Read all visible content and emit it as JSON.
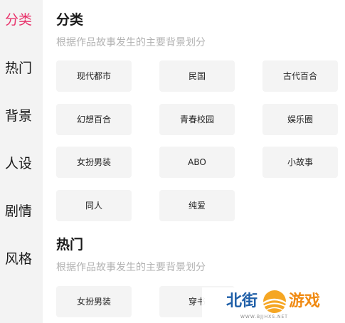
{
  "sidebar": {
    "items": [
      {
        "label": "分类",
        "active": true
      },
      {
        "label": "热门",
        "active": false
      },
      {
        "label": "背景",
        "active": false
      },
      {
        "label": "人设",
        "active": false
      },
      {
        "label": "剧情",
        "active": false
      },
      {
        "label": "风格",
        "active": false
      }
    ]
  },
  "sections": [
    {
      "title": "分类",
      "description": "根据作品故事发生的主要背景划分",
      "tags": [
        "现代都市",
        "民国",
        "古代百合",
        "幻想百合",
        "青春校园",
        "娱乐圈",
        "女扮男装",
        "ABO",
        "小故事",
        "同人",
        "纯爱"
      ]
    },
    {
      "title": "热门",
      "description": "根据作品故事发生的主要背景划分",
      "tags": [
        "女扮男装",
        "穿书"
      ]
    }
  ],
  "watermark": {
    "left_text": "北街",
    "right_text": "游戏",
    "subtext": "WWW.BJJHXS.NET",
    "colors": {
      "left": "#1f5fa8",
      "right": "#f08a12"
    }
  },
  "colors": {
    "accent": "#e8336b",
    "sidebar_bg": "#f3f3f3",
    "tag_bg": "#f4f4f4"
  }
}
